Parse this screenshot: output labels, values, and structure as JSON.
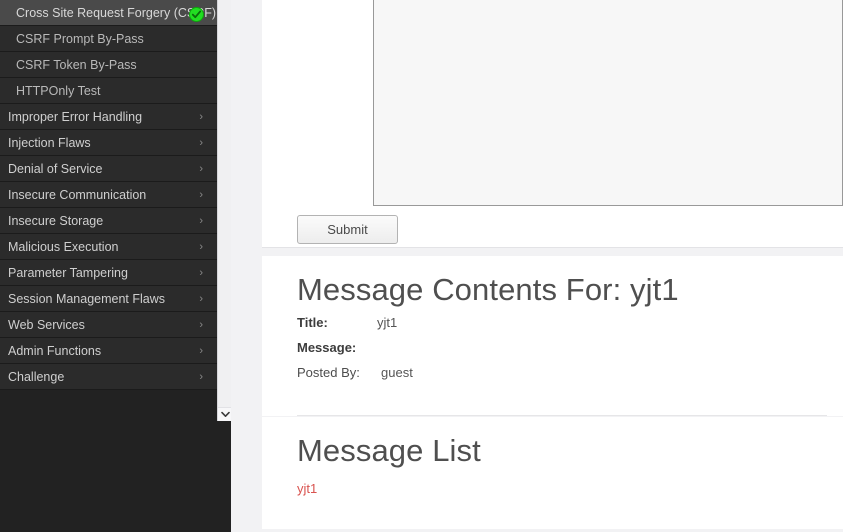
{
  "sidebar": {
    "items": [
      {
        "label": "Cross Site Request Forgery (CSRF)",
        "type": "lesson",
        "active": true,
        "badge": "check-badge-icon"
      },
      {
        "label": "CSRF Prompt By-Pass",
        "type": "lesson",
        "active": false
      },
      {
        "label": "CSRF Token By-Pass",
        "type": "lesson",
        "active": false
      },
      {
        "label": "HTTPOnly Test",
        "type": "lesson",
        "active": false
      },
      {
        "label": "Improper Error Handling",
        "type": "category",
        "chevron": "chevron-right-icon"
      },
      {
        "label": "Injection Flaws",
        "type": "category",
        "chevron": "chevron-right-icon"
      },
      {
        "label": "Denial of Service",
        "type": "category",
        "chevron": "chevron-right-icon"
      },
      {
        "label": "Insecure Communication",
        "type": "category",
        "chevron": "chevron-right-icon"
      },
      {
        "label": "Insecure Storage",
        "type": "category",
        "chevron": "chevron-right-icon"
      },
      {
        "label": "Malicious Execution",
        "type": "category",
        "chevron": "chevron-right-icon"
      },
      {
        "label": "Parameter Tampering",
        "type": "category",
        "chevron": "chevron-right-icon"
      },
      {
        "label": "Session Management Flaws",
        "type": "category",
        "chevron": "chevron-right-icon"
      },
      {
        "label": "Web Services",
        "type": "category",
        "chevron": "chevron-right-icon"
      },
      {
        "label": "Admin Functions",
        "type": "category",
        "chevron": "chevron-right-icon"
      },
      {
        "label": "Challenge",
        "type": "category",
        "chevron": "chevron-right-icon"
      }
    ],
    "scrollbar": {
      "down_arrow_icon": "chevron-down-icon"
    }
  },
  "form": {
    "textarea_value": "",
    "textarea_placeholder": "",
    "submit_label": "Submit"
  },
  "message_contents": {
    "heading": "Message Contents For: yjt1",
    "title_label": "Title:",
    "title_value": "yjt1",
    "message_label": "Message:",
    "message_value": "",
    "posted_by_label": "Posted By:",
    "posted_by_value": "guest"
  },
  "message_list": {
    "heading": "Message List",
    "items": [
      {
        "label": "yjt1"
      }
    ]
  },
  "colors": {
    "sidebar_bg": "#222222",
    "sidebar_item_bg": "#2b2b2b",
    "sidebar_active_bg": "#4a4a4a",
    "content_bg": "#f2f2f4",
    "panel_bg": "#ffffff",
    "link_red": "#d9534f",
    "badge_green": "#22dd22",
    "heading_gray": "#4f4f4f"
  }
}
